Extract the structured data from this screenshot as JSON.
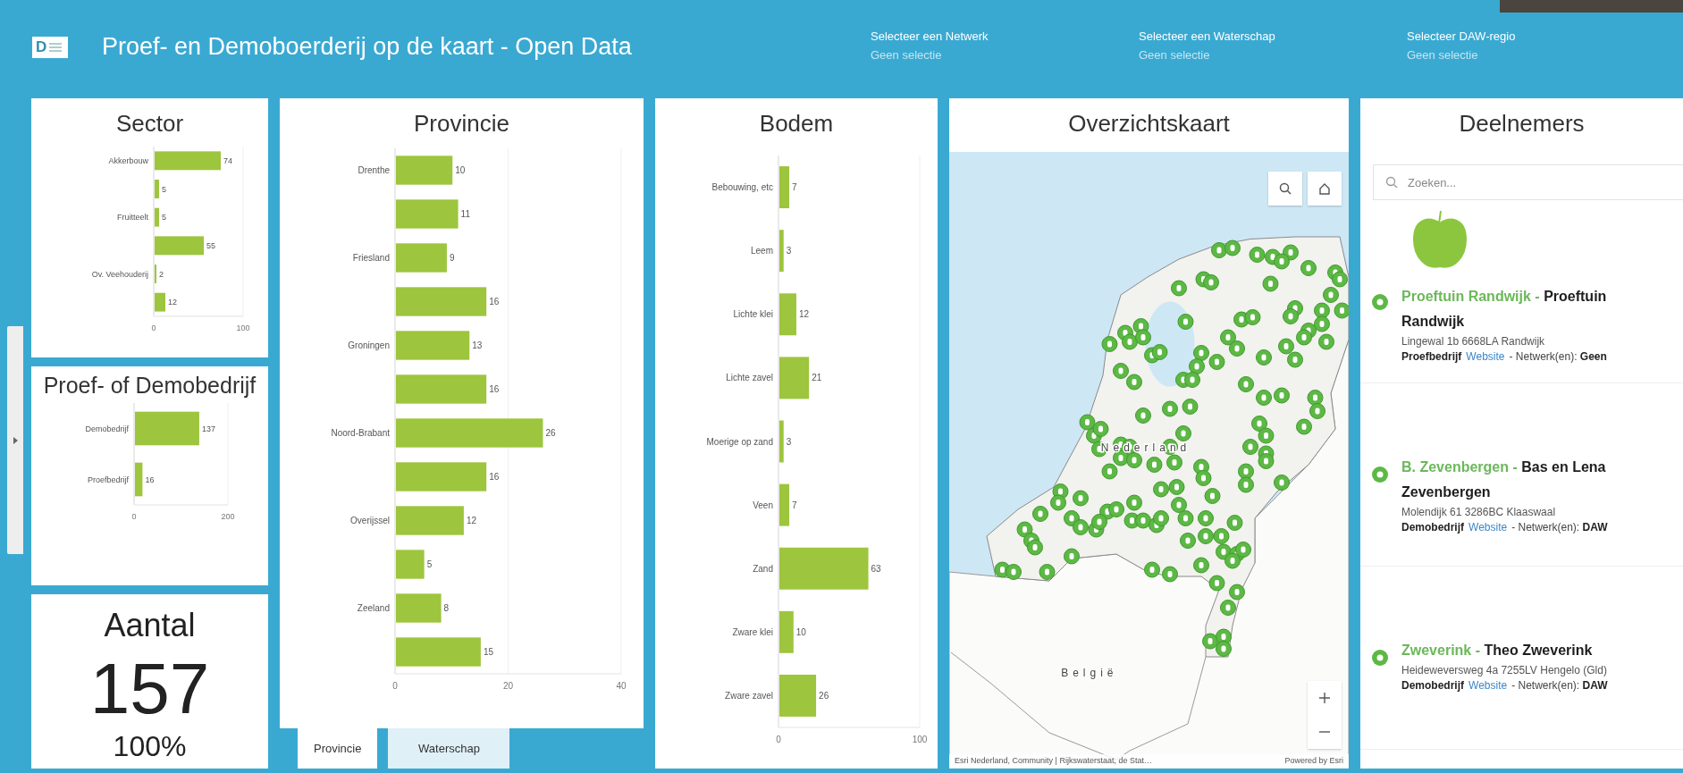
{
  "header": {
    "logo_letter": "D",
    "title": "Proef- en Demoboerderij op de kaart - Open Data",
    "selectors": [
      {
        "label": "Selecteer een Netwerk",
        "value": "Geen selectie"
      },
      {
        "label": "Selecteer een Waterschap",
        "value": "Geen selectie"
      },
      {
        "label": "Selecteer DAW-regio",
        "value": "Geen selectie"
      }
    ]
  },
  "corner_photo": {
    "visible": true
  },
  "sector": {
    "title": "Sector",
    "chart_data": {
      "type": "bar",
      "orientation": "horizontal",
      "categories": [
        "Akkerbouw",
        null,
        "Fruitteelt",
        null,
        "Ov. Veehouderij",
        null
      ],
      "values": [
        74,
        5,
        5,
        55,
        2,
        12
      ],
      "xlim": [
        0,
        100
      ],
      "xticks": [
        0,
        100
      ],
      "data_labels": true
    }
  },
  "bedrijfstype": {
    "title": "Proef- of Demobedrijf",
    "chart_data": {
      "type": "bar",
      "orientation": "horizontal",
      "categories": [
        "Demobedrijf",
        "Proefbedrijf"
      ],
      "values": [
        137,
        16
      ],
      "xlim": [
        0,
        200
      ],
      "xticks": [
        0,
        200
      ],
      "data_labels": true
    }
  },
  "aantal": {
    "title": "Aantal",
    "count": "157",
    "percentage": "100%"
  },
  "provincie": {
    "title": "Provincie",
    "chart_data": {
      "type": "bar",
      "orientation": "horizontal",
      "categories": [
        "Drenthe",
        null,
        "Friesland",
        null,
        "Groningen",
        null,
        "Noord-Brabant",
        null,
        "Overijssel",
        null,
        "Zeeland",
        null
      ],
      "values": [
        10,
        11,
        9,
        16,
        13,
        16,
        26,
        16,
        12,
        5,
        8,
        15
      ],
      "xlim": [
        0,
        40
      ],
      "xticks": [
        0,
        20,
        40
      ],
      "data_labels": true
    },
    "tabs": [
      {
        "label": "Provincie",
        "selected": true
      },
      {
        "label": "Waterschap",
        "selected": false
      }
    ]
  },
  "bodem": {
    "title": "Bodem",
    "chart_data": {
      "type": "bar",
      "orientation": "horizontal",
      "categories": [
        "Bebouwing, etc",
        "Leem",
        "Lichte klei",
        "Lichte zavel",
        "Moerige op zand",
        "Veen",
        "Zand",
        "Zware klei",
        "Zware zavel"
      ],
      "values": [
        7,
        3,
        12,
        21,
        3,
        7,
        63,
        10,
        26
      ],
      "xlim": [
        0,
        100
      ],
      "xticks": [
        0,
        100
      ],
      "data_labels": true
    }
  },
  "map": {
    "title": "Overzichtskaart",
    "place_labels": [
      "Nederland",
      "België"
    ],
    "attribution": "Esri Nederland, Community | Rijkswaterstaat, de Stat…",
    "credit": "Powered by Esri"
  },
  "deelnemers": {
    "title": "Deelnemers",
    "search": {
      "placeholder": "Zoeken..."
    },
    "items": [
      {
        "has_image": true,
        "title": "Proeftuin Randwijk - **Proeftuin Randwijk**",
        "address": "Lingewal 1b 6668LA Randwijk",
        "type": "Proefbedrijf",
        "link": "Website",
        "networks": "- Netwerk(en): **Geen**"
      },
      {
        "has_image": false,
        "title": "B. Zevenbergen - **Bas en Lena Zevenbergen**",
        "address": "Molendijk 61 3286BC Klaaswaal",
        "type": "Demobedrijf",
        "link": "Website",
        "networks": "- Netwerk(en): **DAW**"
      },
      {
        "has_image": false,
        "title": "Zweverink - **Theo Zweverink**",
        "address": "Heideweversweg 4a 7255LV Hengelo (Gld)",
        "type": "Demobedrijf",
        "link": "Website",
        "networks": "- Netwerk(en): **DAW**"
      }
    ]
  }
}
